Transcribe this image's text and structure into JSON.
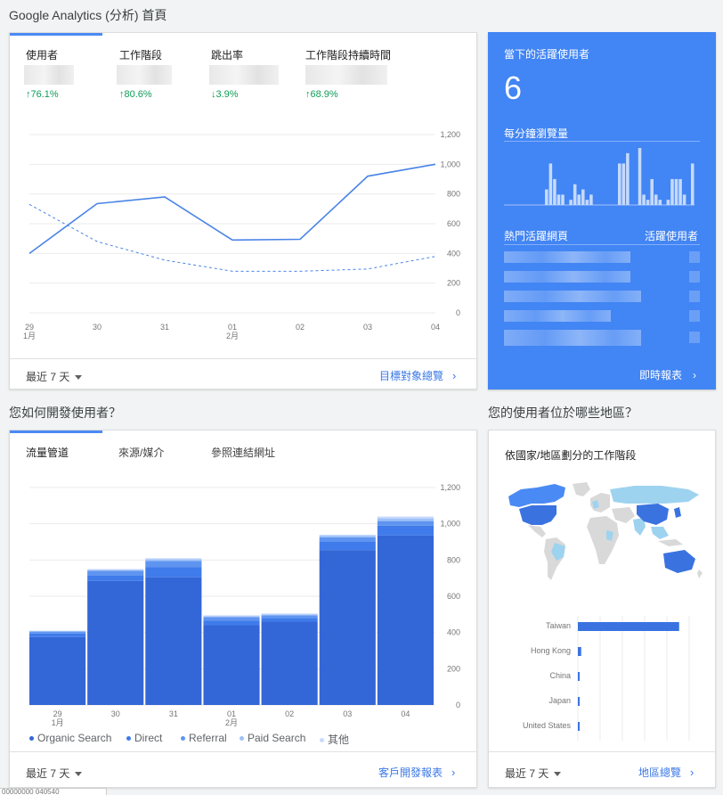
{
  "app": {
    "title": "Google Analytics (分析) 首頁"
  },
  "overview": {
    "metrics": [
      {
        "label": "使用者",
        "change": "↑76.1%"
      },
      {
        "label": "工作階段",
        "change": "↑80.6%"
      },
      {
        "label": "跳出率",
        "change": "↓3.9%"
      },
      {
        "label": "工作階段持續時間",
        "change": "↑68.9%"
      }
    ],
    "range_label": "最近 7 天",
    "link_label": "目標對象總覽"
  },
  "realtime": {
    "title": "當下的活躍使用者",
    "active_users": "6",
    "pageviews_label": "每分鐘瀏覽量",
    "pageviews_per_minute": [
      0,
      0,
      0,
      0,
      0,
      0,
      0,
      0,
      0,
      0,
      3,
      8,
      5,
      2,
      2,
      0,
      1,
      4,
      2,
      3,
      1,
      2,
      0,
      0,
      0,
      0,
      0,
      0,
      8,
      8,
      10,
      0,
      0,
      11,
      2,
      1,
      5,
      2,
      1,
      0,
      1,
      5,
      5,
      5,
      2,
      0,
      8
    ],
    "col_pages": "熱門活躍網頁",
    "col_users": "活躍使用者",
    "link_label": "即時報表"
  },
  "acquisition": {
    "section_title": "您如何開發使用者？",
    "tabs": [
      "流量管道",
      "來源/媒介",
      "參照連結網址"
    ],
    "range_label": "最近 7 天",
    "link_label": "客戶開發報表",
    "legend": [
      "Organic Search",
      "Direct",
      "Referral",
      "Paid Search",
      "其他"
    ]
  },
  "geo": {
    "section_title": "您的使用者位於哪些地區？",
    "card_title": "依國家/地區劃分的工作階段",
    "range_label": "最近 7 天",
    "link_label": "地區總覽"
  },
  "footer_strip": "00000000 040540",
  "colors": {
    "accent": "#4285f4",
    "link": "#3b78e7",
    "positive": "#0f9d58",
    "series_dark": "#3366d6",
    "series_light": "#9fc1f7"
  },
  "chart_data": [
    {
      "type": "line",
      "x": [
        "29 1月",
        "30",
        "31",
        "01 2月",
        "02",
        "03",
        "04"
      ],
      "series": [
        {
          "values": [
            400,
            735,
            780,
            490,
            495,
            920,
            1000
          ],
          "style": "solid"
        },
        {
          "values": [
            730,
            480,
            355,
            280,
            280,
            295,
            380
          ],
          "style": "dashed"
        }
      ],
      "yticks": [
        0,
        200,
        400,
        600,
        800,
        1000,
        1200
      ],
      "ylim": [
        0,
        1200
      ],
      "grid": true
    },
    {
      "type": "bar",
      "stacked": true,
      "categories": [
        "29 1月",
        "30",
        "31",
        "01 2月",
        "02",
        "03",
        "04"
      ],
      "series": [
        {
          "name": "Organic Search",
          "values": [
            375,
            685,
            705,
            440,
            460,
            855,
            935
          ]
        },
        {
          "name": "Direct",
          "values": [
            20,
            30,
            55,
            25,
            20,
            45,
            55
          ]
        },
        {
          "name": "Referral",
          "values": [
            10,
            25,
            35,
            20,
            15,
            25,
            25
          ]
        },
        {
          "name": "Paid Search",
          "values": [
            3,
            5,
            10,
            5,
            5,
            10,
            15
          ]
        },
        {
          "name": "其他",
          "values": [
            2,
            5,
            5,
            5,
            5,
            5,
            10
          ]
        }
      ],
      "yticks": [
        0,
        200,
        400,
        600,
        800,
        1000,
        1200
      ],
      "ylim": [
        0,
        1200
      ],
      "grid": true
    },
    {
      "type": "bar",
      "orientation": "horizontal",
      "categories": [
        "Taiwan",
        "Hong Kong",
        "China",
        "Japan",
        "United States"
      ],
      "values": [
        91,
        3,
        1.5,
        1.5,
        1
      ],
      "xticks": [
        "0%",
        "20%",
        "40%",
        "60%",
        "80%",
        "100%"
      ],
      "xlim": [
        0,
        100
      ]
    }
  ]
}
